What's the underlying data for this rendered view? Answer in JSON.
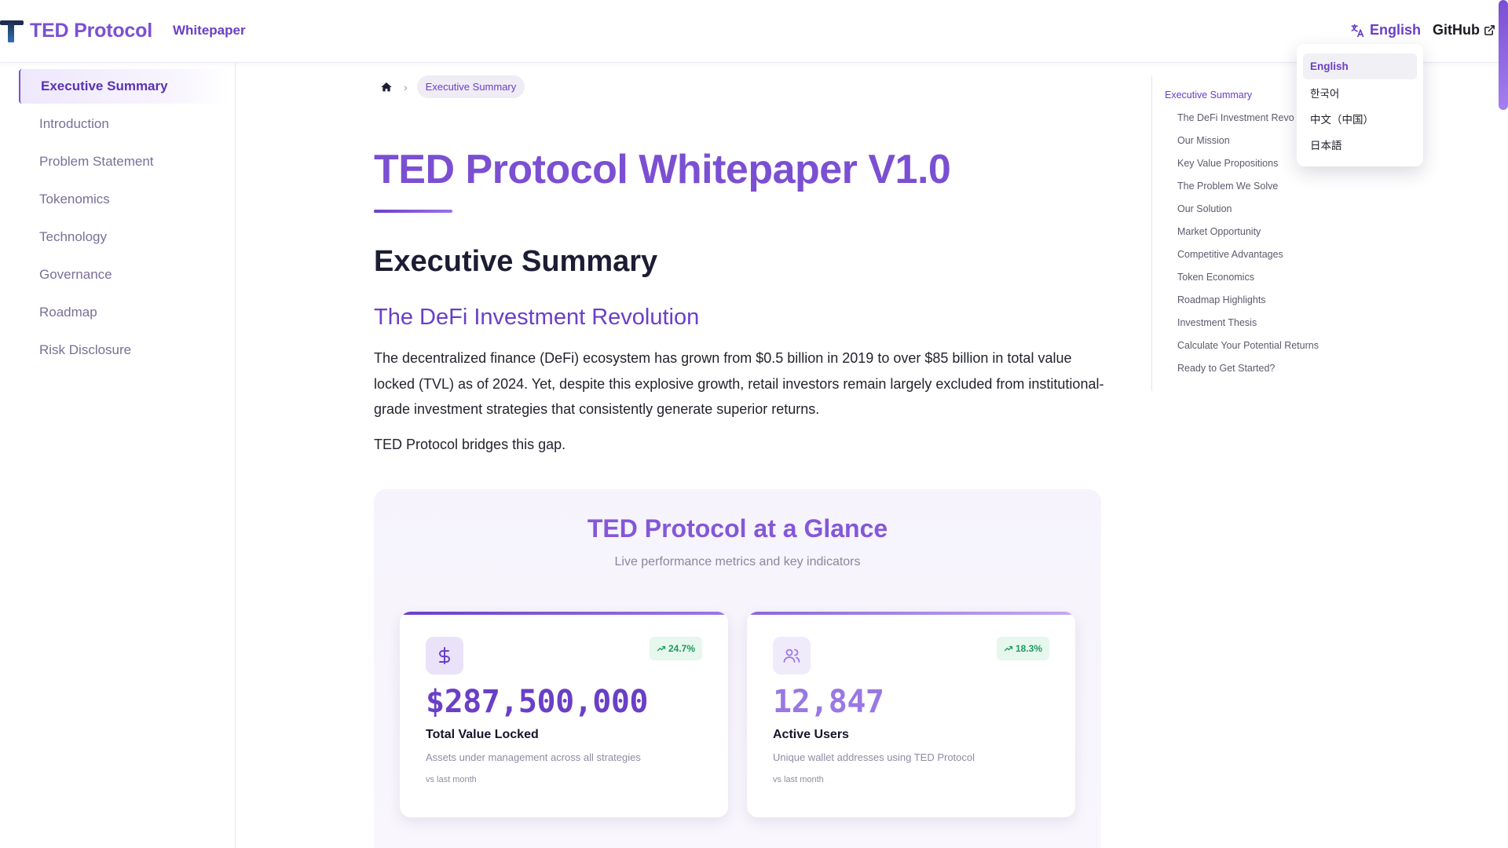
{
  "header": {
    "logo_text": "TED Protocol",
    "nav_whitepaper": "Whitepaper",
    "language_label": "English",
    "github_label": "GitHub"
  },
  "language_menu": {
    "options": [
      "English",
      "한국어",
      "中文（中国）",
      "日本語"
    ],
    "selected": "English"
  },
  "sidebar": {
    "items": [
      {
        "label": "Executive Summary",
        "active": true
      },
      {
        "label": "Introduction"
      },
      {
        "label": "Problem Statement"
      },
      {
        "label": "Tokenomics"
      },
      {
        "label": "Technology"
      },
      {
        "label": "Governance"
      },
      {
        "label": "Roadmap"
      },
      {
        "label": "Risk Disclosure"
      }
    ]
  },
  "breadcrumb": {
    "home_icon": "home-icon",
    "current": "Executive Summary"
  },
  "main": {
    "title": "TED Protocol Whitepaper V1.0",
    "section_heading": "Executive Summary",
    "subheading": "The DeFi Investment Revolution",
    "paragraph": "The decentralized finance (DeFi) ecosystem has grown from $0.5 billion in 2019 to over $85 billion in total value locked (TVL) as of 2024. Yet, despite this explosive growth, retail investors remain largely excluded from institutional-grade investment strategies that consistently generate superior returns.",
    "paragraph2": "TED Protocol bridges this gap."
  },
  "glance": {
    "title": "TED Protocol at a Glance",
    "subtitle": "Live performance metrics and key indicators",
    "cards": [
      {
        "icon": "dollar-icon",
        "change": "24.7%",
        "value": "$287,500,000",
        "label": "Total Value Locked",
        "description": "Assets under management across all strategies",
        "footnote": "vs last month"
      },
      {
        "icon": "users-icon",
        "change": "18.3%",
        "value": "12,847",
        "label": "Active Users",
        "description": "Unique wallet addresses using TED Protocol",
        "footnote": "vs last month"
      }
    ]
  },
  "toc": {
    "items": [
      {
        "label": "Executive Summary",
        "level": 1
      },
      {
        "label": "The DeFi Investment Revo",
        "level": 2
      },
      {
        "label": "Our Mission",
        "level": 2
      },
      {
        "label": "Key Value Propositions",
        "level": 2
      },
      {
        "label": "The Problem We Solve",
        "level": 2
      },
      {
        "label": "Our Solution",
        "level": 2
      },
      {
        "label": "Market Opportunity",
        "level": 2
      },
      {
        "label": "Competitive Advantages",
        "level": 2
      },
      {
        "label": "Token Economics",
        "level": 2
      },
      {
        "label": "Roadmap Highlights",
        "level": 2
      },
      {
        "label": "Investment Thesis",
        "level": 2
      },
      {
        "label": "Calculate Your Potential Returns",
        "level": 2
      },
      {
        "label": "Ready to Get Started?",
        "level": 2
      }
    ]
  },
  "colors": {
    "accent": "#7b4fd2",
    "accent_dark": "#6a3fc7",
    "positive": "#1f9a5b",
    "positive_bg": "#e6f7ee"
  }
}
